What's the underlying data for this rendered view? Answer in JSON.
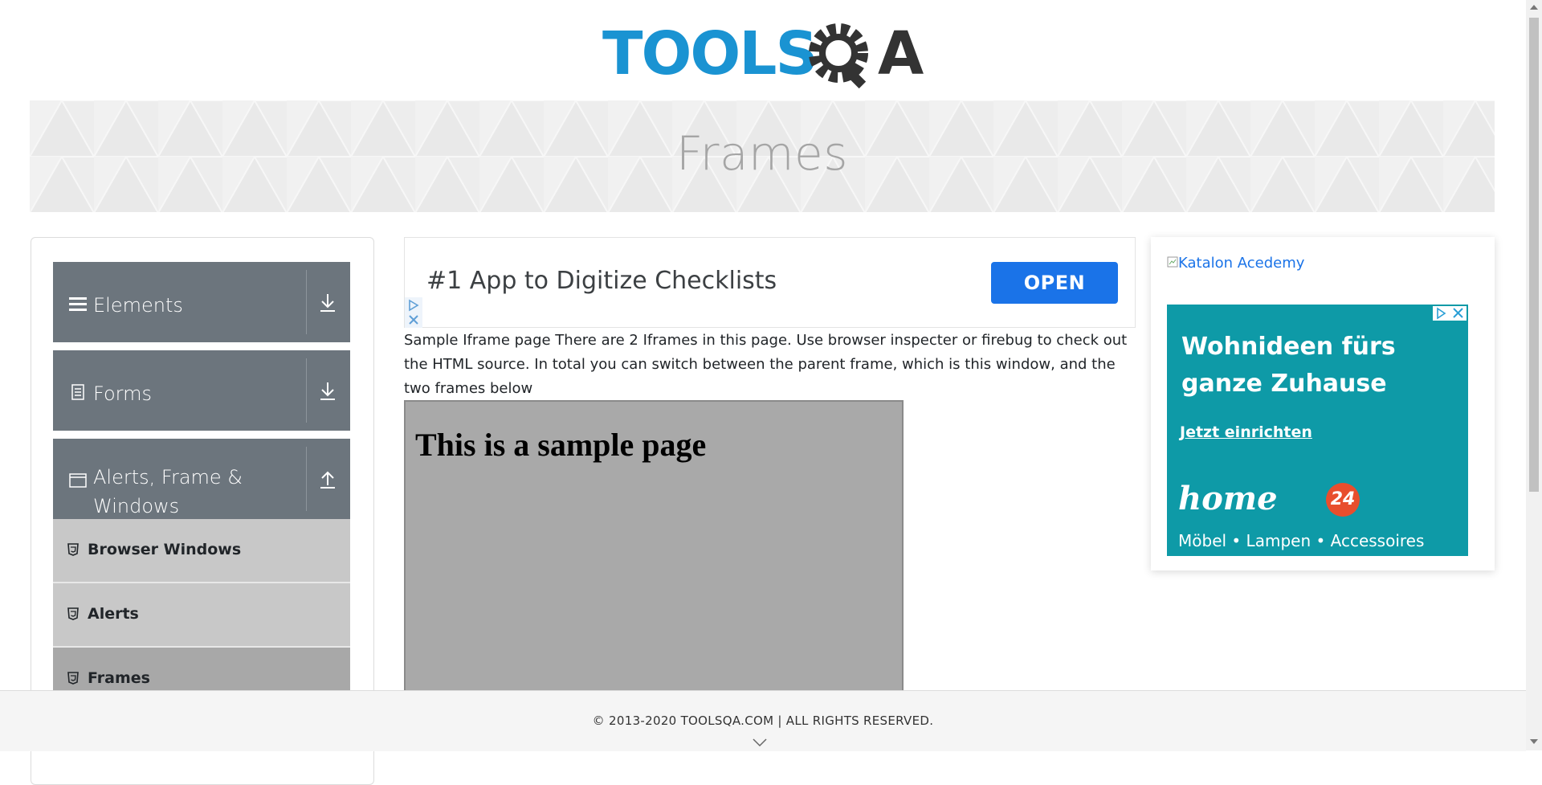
{
  "logo": {
    "text_left": "TOOLS",
    "text_right": "A",
    "brand_blue": "#1a93d2",
    "brand_dark": "#333333"
  },
  "banner": {
    "title": "Frames"
  },
  "sidebar": {
    "groups": [
      {
        "label": "Elements",
        "icon": "menu-icon",
        "arrow": "download-icon"
      },
      {
        "label": "Forms",
        "icon": "document-icon",
        "arrow": "download-icon"
      },
      {
        "label": "Alerts, Frame & Windows",
        "icon": "window-icon",
        "arrow": "upload-icon"
      }
    ],
    "items": [
      {
        "label": "Browser Windows",
        "icon": "html5-icon",
        "active": false
      },
      {
        "label": "Alerts",
        "icon": "html5-icon",
        "active": false
      },
      {
        "label": "Frames",
        "icon": "html5-icon",
        "active": true
      }
    ]
  },
  "top_ad": {
    "headline": "#1 App to Digitize Checklists",
    "button_label": "OPEN",
    "button_color": "#1a73e8"
  },
  "main": {
    "description": "Sample Iframe page There are 2 Iframes in this page. Use browser inspecter or firebug to check out the HTML source. In total you can switch between the parent frame, which is this window, and the two frames below",
    "frame_heading": "This is a sample page"
  },
  "right_ad": {
    "image_alt": "Katalon Acedemy",
    "headline": "Wohnideen fürs ganze Zuhause",
    "cta": "Jetzt einrichten",
    "brand": "home",
    "brand_badge": "24",
    "tagline": "Möbel • Lampen • Accessoires",
    "bg_color": "#0e9aa7"
  },
  "footer": {
    "copyright": "© 2013-2020 TOOLSQA.COM | ALL RIGHTS RESERVED."
  }
}
